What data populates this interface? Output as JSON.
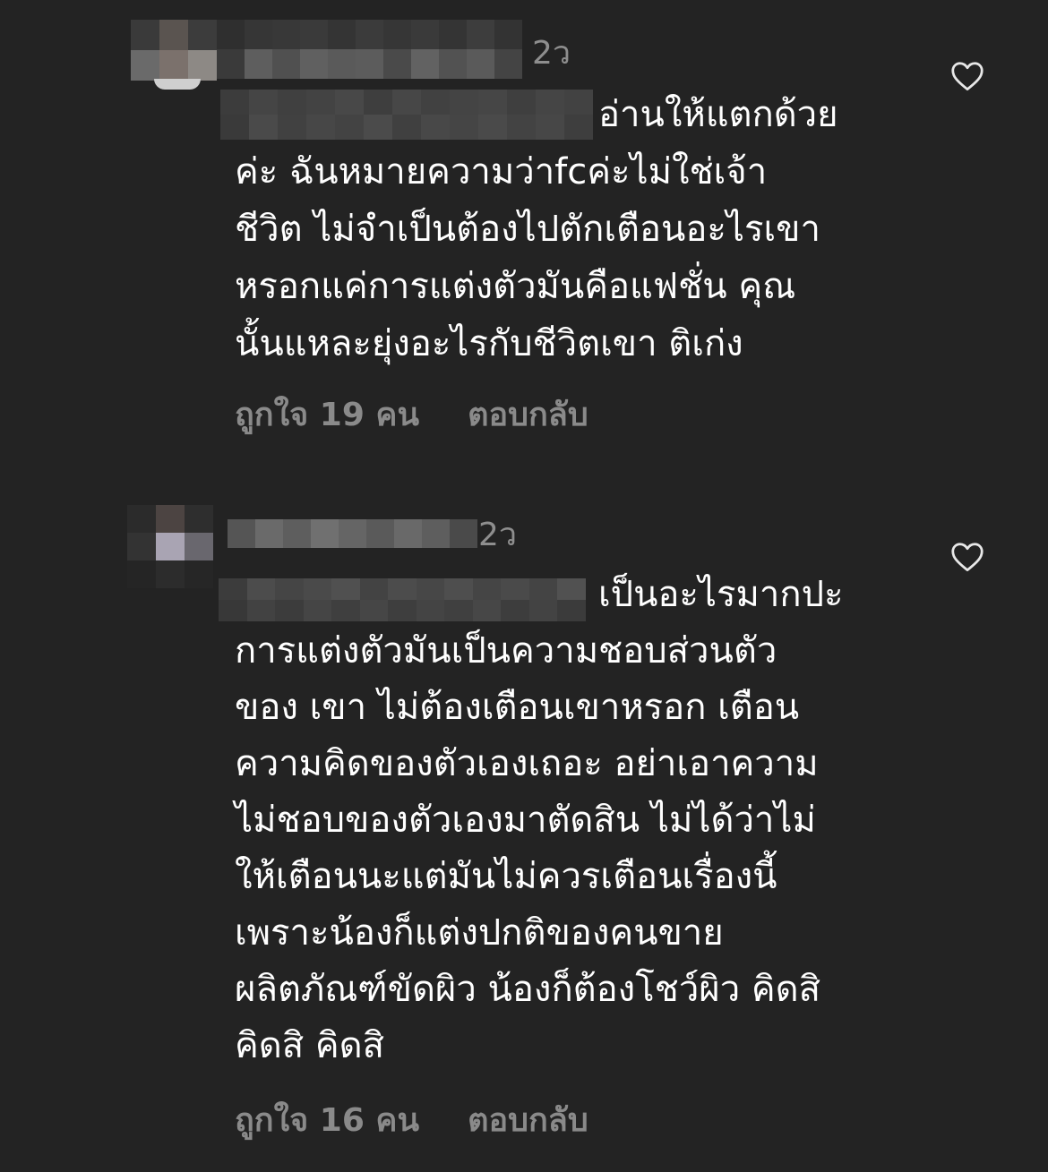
{
  "comments": [
    {
      "time": "2ว",
      "first_line": "อ่านให้แตกด้วย",
      "text": "ค่ะ ฉันหมายความว่าfcค่ะไม่ใช่เจ้า\nชีวิต ไม่จำเป็นต้องไปตักเตือนอะไรเขา\nหรอกแค่การแต่งตัวมันคือแฟชั่น คุณ\nนั้นแหละยุ่งอะไรกับชีวิตเขา ติเก่ง",
      "likes": "ถูกใจ 19 คน",
      "reply": "ตอบกลับ"
    },
    {
      "time": "2ว",
      "first_line": "เป็นอะไรมากปะ",
      "text": "การแต่งตัวมันเป็นความชอบส่วนตัว\nของ เขา ไม่ต้องเตือนเขาหรอก เตือน\nความคิดของตัวเองเถอะ อย่าเอาความ\nไม่ชอบของตัวเองมาตัดสิน ไม่ได้ว่าไม่\nให้เตือนนะแต่มันไม่ควรเตือนเรื่องนี้\nเพราะน้องก็แต่งปกติของคนขาย\nผลิตภัณฑ์ขัดผิว น้องก็ต้องโชว์ผิว คิดสิ\nคิดสิ คิดสิ",
      "likes": "ถูกใจ 16 คน",
      "reply": "ตอบกลับ"
    }
  ],
  "icons": {
    "like": "heart-outline-icon"
  },
  "colors": {
    "background": "#232323",
    "text": "#ffffff",
    "muted": "#8e8e8e"
  }
}
